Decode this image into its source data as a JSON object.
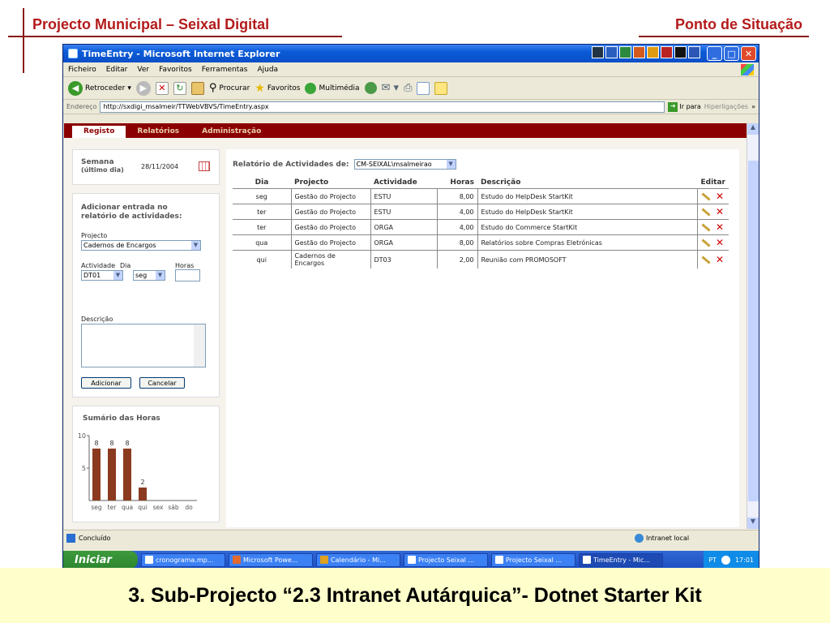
{
  "slide": {
    "title_left": "Projecto Municipal – Seixal Digital",
    "title_right": "Ponto de Situação",
    "footer": "3. Sub-Projecto “2.3 Intranet Autárquica”- Dotnet Starter Kit"
  },
  "window": {
    "title": "TimeEntry - Microsoft Internet Explorer"
  },
  "menu": [
    "Ficheiro",
    "Editar",
    "Ver",
    "Favoritos",
    "Ferramentas",
    "Ajuda"
  ],
  "toolbar": {
    "back": "Retroceder",
    "search": "Procurar",
    "favorites": "Favoritos",
    "media": "Multimédia"
  },
  "address": {
    "label": "Endereço",
    "url": "http://sxdigi_msalmeir/TTWebVBVS/TimeEntry.aspx",
    "go": "Ir para",
    "links": "Hiperligações"
  },
  "tabs": [
    "Registo",
    "Relatórios",
    "Administração"
  ],
  "week": {
    "label_line1": "Semana",
    "label_line2": "(último dia)",
    "date": "28/11/2004"
  },
  "form": {
    "heading_line1": "Adicionar entrada no",
    "heading_line2": "relatório de actividades:",
    "project_label": "Projecto",
    "project_value": "Cadernos de Encargos",
    "activity_label": "Actividade",
    "activity_value": "DT01",
    "day_label": "Dia",
    "day_value": "seg",
    "hours_label": "Horas",
    "hours_value": "",
    "description_label": "Descrição",
    "add_button": "Adicionar",
    "cancel_button": "Cancelar"
  },
  "summary": {
    "heading": "Sumário das Horas",
    "chart_data": {
      "type": "bar",
      "categories": [
        "seg",
        "ter",
        "qua",
        "qui",
        "sex",
        "sáb",
        "do"
      ],
      "values": [
        8,
        8,
        8,
        2,
        0,
        0,
        0
      ],
      "data_labels": [
        "8",
        "8",
        "8",
        "2",
        "",
        "",
        ""
      ],
      "yticks": [
        "10",
        "5"
      ],
      "ylim": [
        0,
        10
      ],
      "color": "#8b3a1f"
    }
  },
  "report": {
    "label": "Relatório de Actividades de:",
    "user": "CM-SEIXAL\\msalmeirao",
    "columns": [
      "Dia",
      "Projecto",
      "Actividade",
      "Horas",
      "Descrição",
      "Editar"
    ],
    "rows": [
      {
        "dia": "seg",
        "projecto": "Gestão do Projecto",
        "actividade": "ESTU",
        "horas": "8,00",
        "descricao": "Estudo do HelpDesk StartKit"
      },
      {
        "dia": "ter",
        "projecto": "Gestão do Projecto",
        "actividade": "ESTU",
        "horas": "4,00",
        "descricao": "Estudo do HelpDesk StartKit"
      },
      {
        "dia": "ter",
        "projecto": "Gestão do Projecto",
        "actividade": "ORGA",
        "horas": "4,00",
        "descricao": "Estudo do Commerce StartKit"
      },
      {
        "dia": "qua",
        "projecto": "Gestão do Projecto",
        "actividade": "ORGA",
        "horas": "8,00",
        "descricao": "Relatórios sobre Compras Eletrónicas"
      },
      {
        "dia": "qui",
        "projecto": "Cadernos de Encargos",
        "actividade": "DT03",
        "horas": "2,00",
        "descricao": "Reunião com PROMOSOFT"
      }
    ]
  },
  "status": {
    "left": "Concluído",
    "zone": "Intranet local"
  },
  "taskbar": {
    "start": "Iniciar",
    "tasks": [
      "cronograma.mp...",
      "Microsoft Powe...",
      "Calendário - Mi...",
      "Projecto Seixal ...",
      "Projecto Seixal ...",
      "TimeEntry - Mic..."
    ],
    "lang": "PT",
    "clock": "17:01"
  },
  "colors": {
    "accent": "#8b0000",
    "title_red": "#b31b1b",
    "footer_bg": "#ffffcc"
  }
}
